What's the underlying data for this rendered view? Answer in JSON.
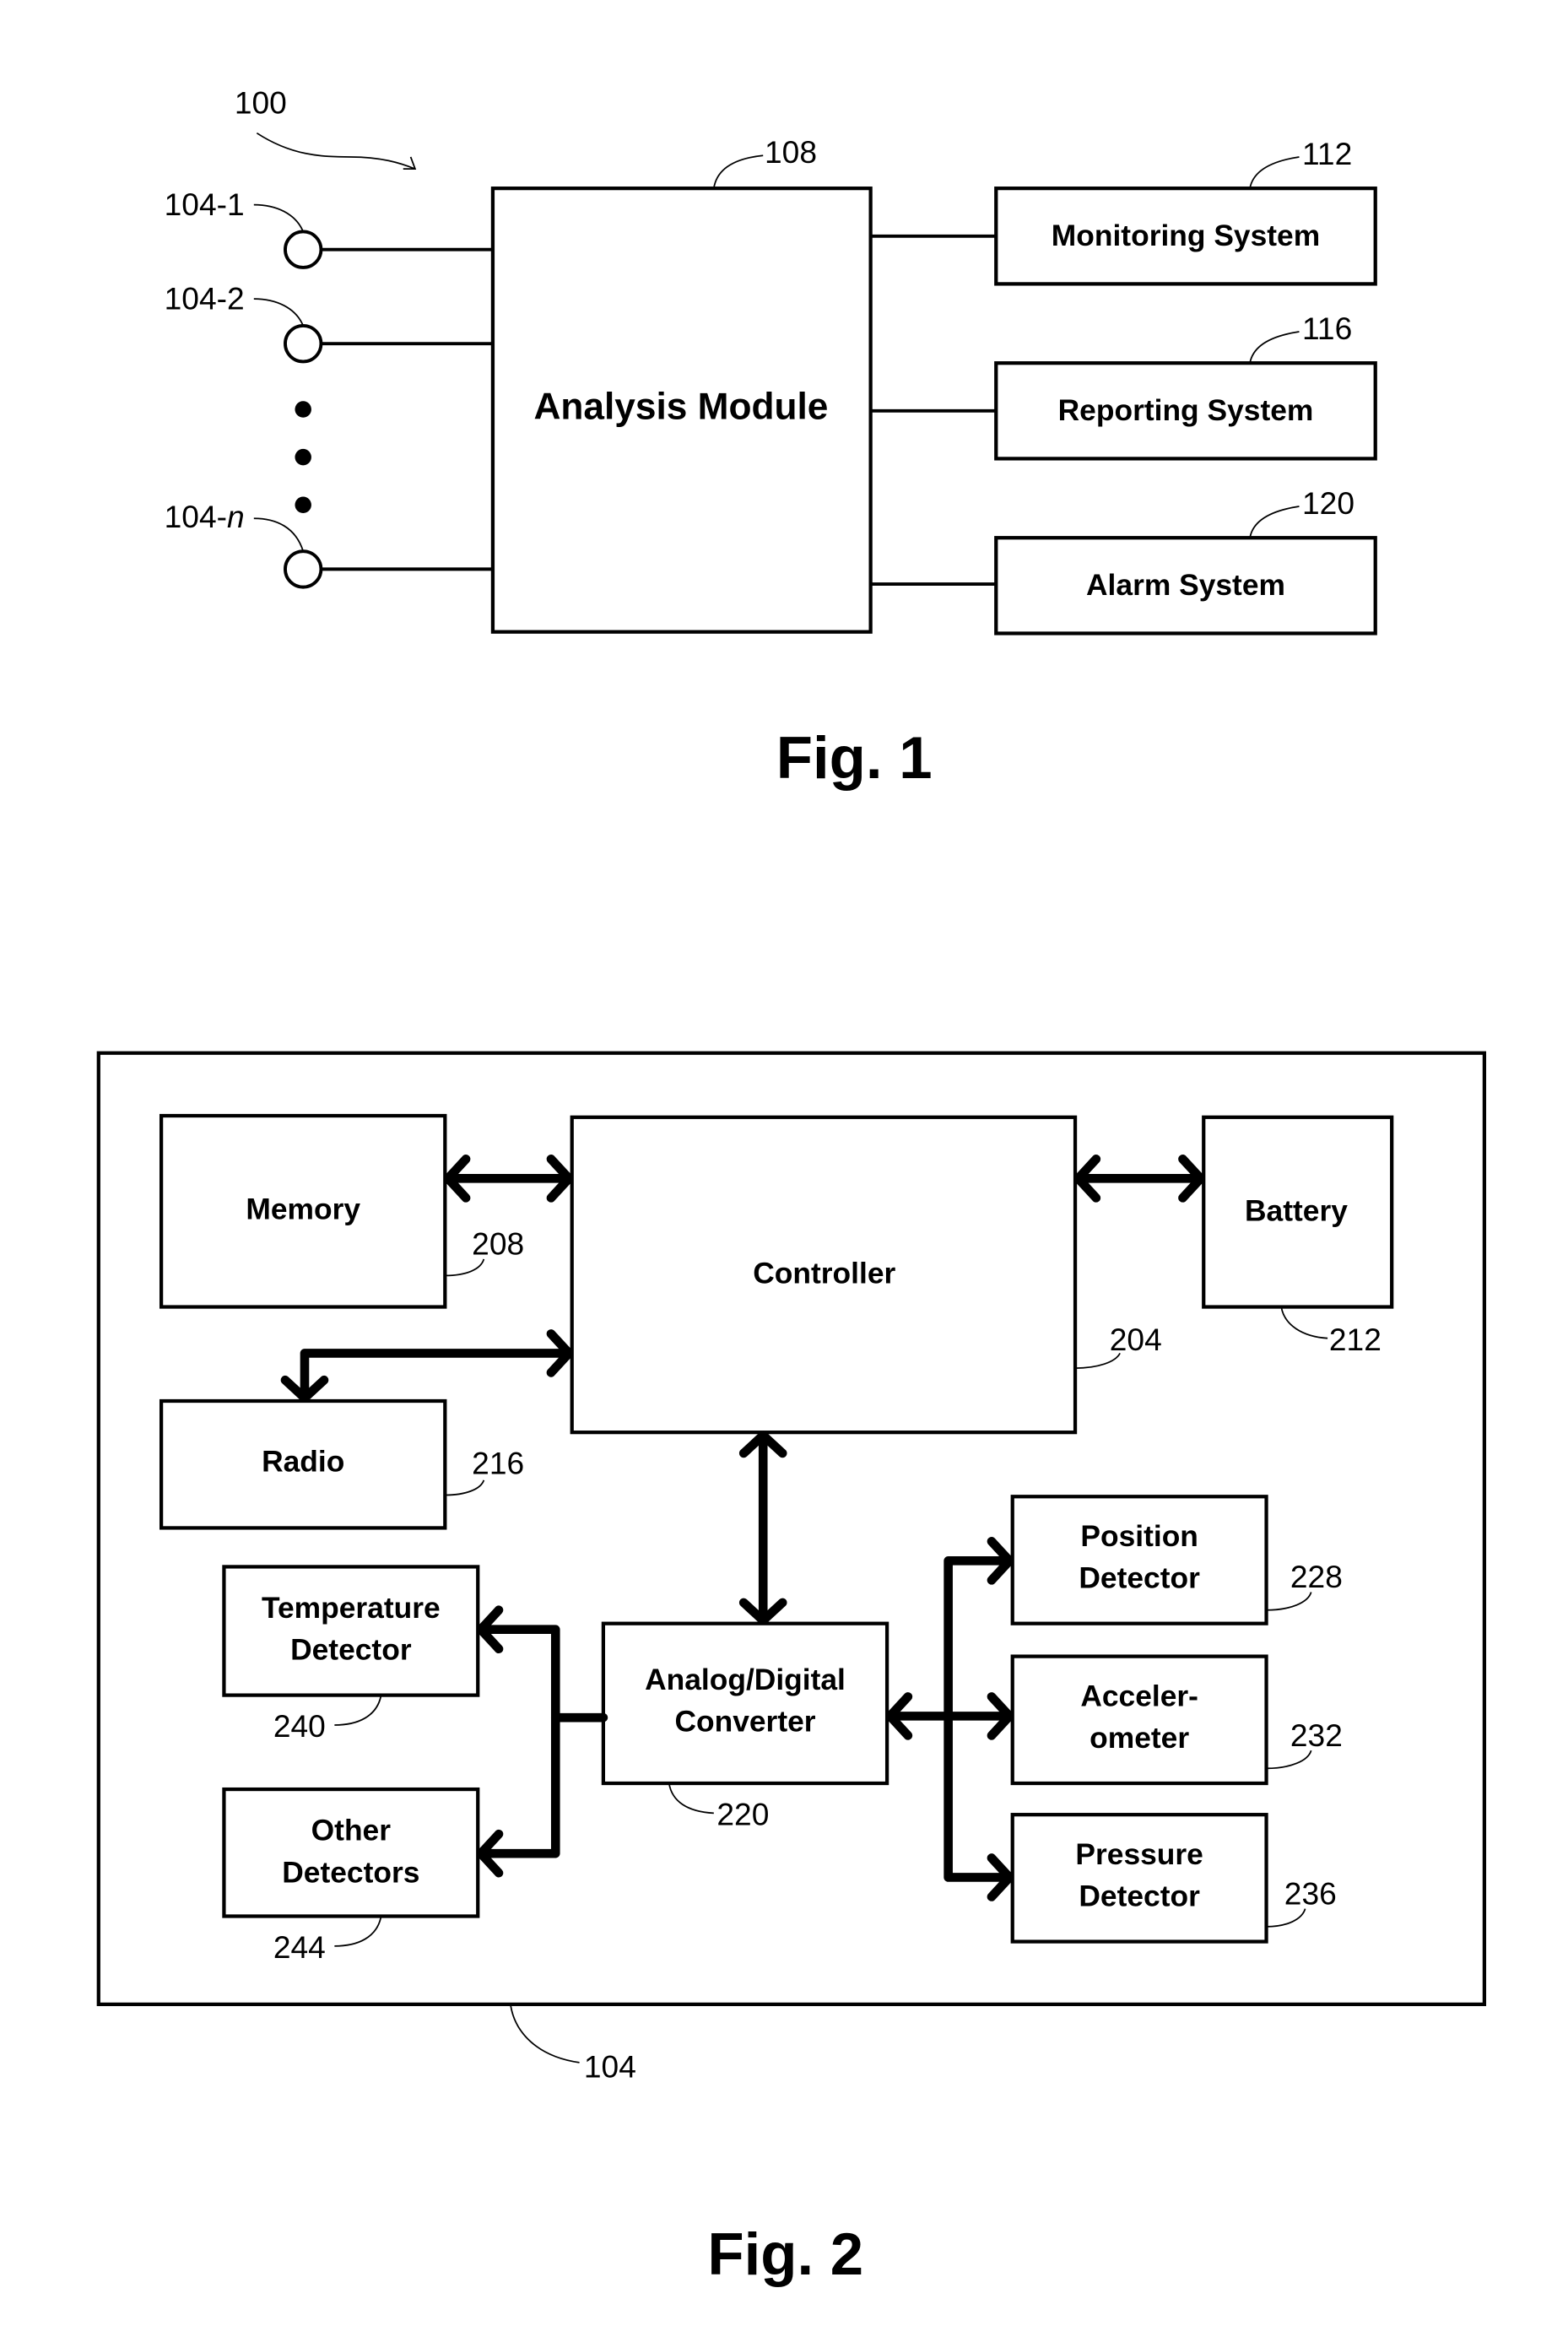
{
  "figure1": {
    "caption": "Fig. 1",
    "system_ref": "100",
    "analysis_module": {
      "label": "Analysis Module",
      "ref": "108"
    },
    "sensors": [
      {
        "ref_prefix": "104-",
        "ref_suffix": "1"
      },
      {
        "ref_prefix": "104-",
        "ref_suffix": "2"
      },
      {
        "ref_prefix": "104-",
        "ref_suffix": "n"
      }
    ],
    "outputs": [
      {
        "label": "Monitoring System",
        "ref": "112"
      },
      {
        "label": "Reporting System",
        "ref": "116"
      },
      {
        "label": "Alarm System",
        "ref": "120"
      }
    ]
  },
  "figure2": {
    "caption": "Fig. 2",
    "device_ref": "104",
    "memory": {
      "label": "Memory",
      "ref": "208"
    },
    "controller": {
      "label": "Controller",
      "ref": "204"
    },
    "battery": {
      "label": "Battery",
      "ref": "212"
    },
    "radio": {
      "label": "Radio",
      "ref": "216"
    },
    "adc": {
      "label_line1": "Analog/Digital",
      "label_line2": "Converter",
      "ref": "220"
    },
    "temperature": {
      "label_line1": "Temperature",
      "label_line2": "Detector",
      "ref": "240"
    },
    "other": {
      "label_line1": "Other",
      "label_line2": "Detectors",
      "ref": "244"
    },
    "position": {
      "label_line1": "Position",
      "label_line2": "Detector",
      "ref": "228"
    },
    "accelerometer": {
      "label_line1": "Acceler-",
      "label_line2": "ometer",
      "ref": "232"
    },
    "pressure": {
      "label_line1": "Pressure",
      "label_line2": "Detector",
      "ref": "236"
    }
  }
}
